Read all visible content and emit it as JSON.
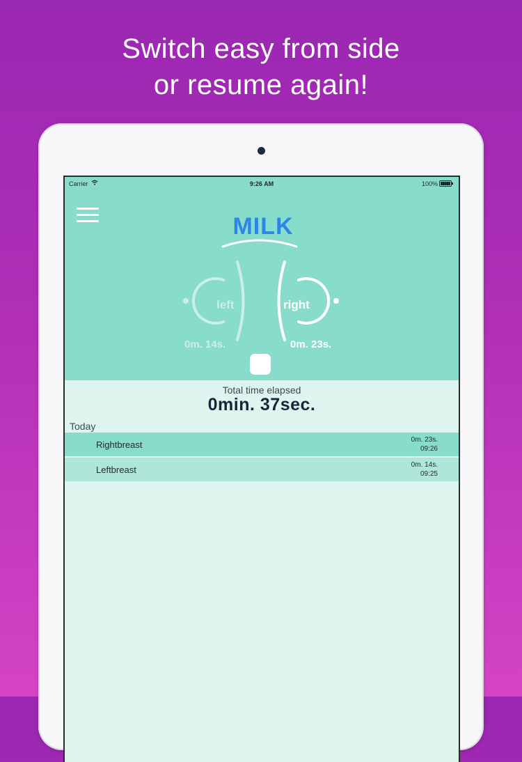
{
  "headline": {
    "line1": "Switch easy from side",
    "line2": "or resume again!"
  },
  "status_bar": {
    "carrier": "Carrier",
    "time": "9:26 AM",
    "battery": "100%"
  },
  "app": {
    "logo": "MILK",
    "gauges": {
      "left": {
        "label": "left",
        "time": "0m. 14s."
      },
      "right": {
        "label": "right",
        "time": "0m. 23s."
      }
    },
    "elapsed": {
      "label": "Total time elapsed",
      "value": "0min. 37sec."
    },
    "history": {
      "section": "Today",
      "entries": [
        {
          "name": "Rightbreast",
          "duration": "0m. 23s.",
          "time": "09:26"
        },
        {
          "name": "Leftbreast",
          "duration": "0m. 14s.",
          "time": "09:25"
        }
      ]
    }
  },
  "colors": {
    "accent": "#87dccb",
    "logo": "#2b86e6",
    "background": "#def4ef"
  },
  "icons": {
    "menu": "hamburger-menu-icon",
    "stop": "stop-square-icon",
    "wifi": "wifi-icon",
    "battery": "battery-icon"
  }
}
